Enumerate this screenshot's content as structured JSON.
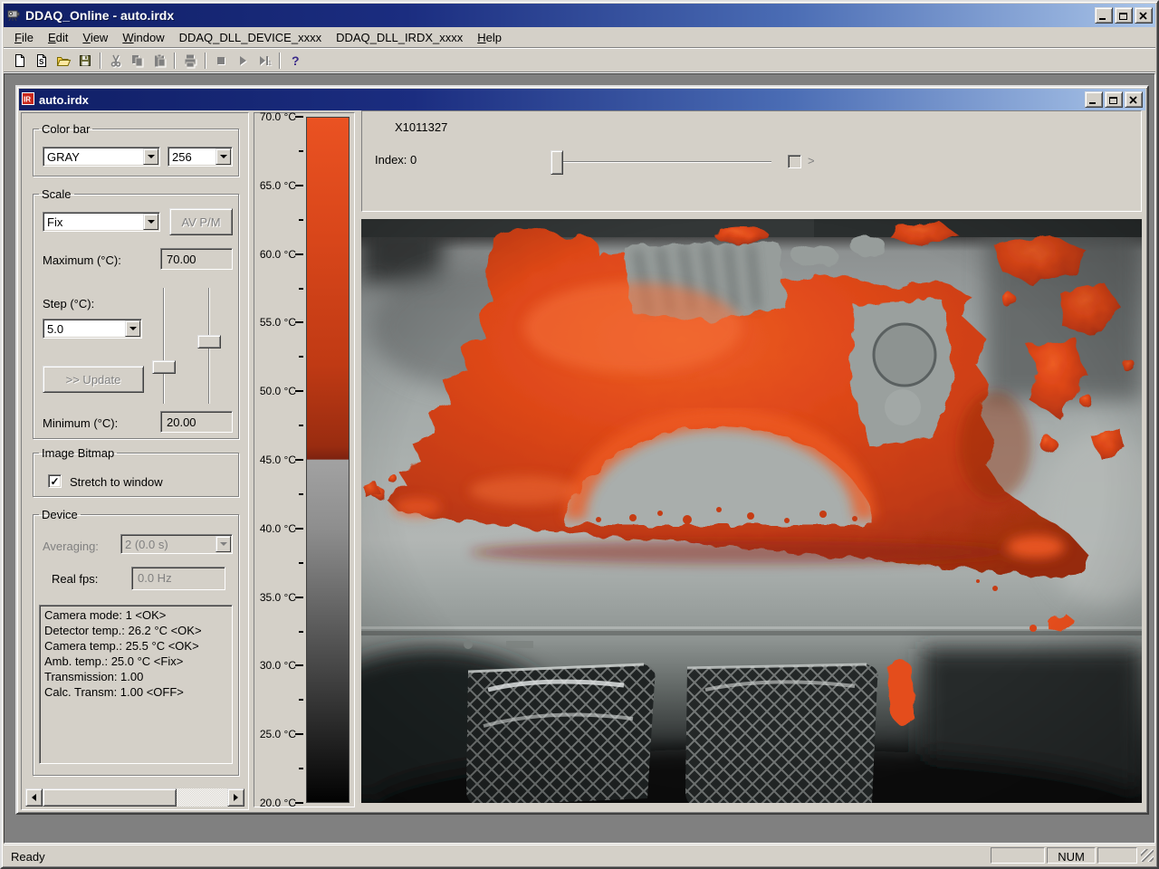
{
  "window": {
    "title": "DDAQ_Online - auto.irdx"
  },
  "menu": {
    "items": [
      {
        "label": "File"
      },
      {
        "label": "Edit"
      },
      {
        "label": "View"
      },
      {
        "label": "Window"
      },
      {
        "label": "DDAQ_DLL_DEVICE_xxxx"
      },
      {
        "label": "DDAQ_DLL_IRDX_xxxx"
      },
      {
        "label": "Help"
      }
    ]
  },
  "toolbar": {
    "buttons": [
      "new-file",
      "new-irdx",
      "open-file",
      "save-file",
      "cut",
      "copy",
      "paste",
      "print",
      "stop",
      "play",
      "play-single",
      "help-about"
    ]
  },
  "child": {
    "title": "auto.irdx"
  },
  "panel": {
    "colorbar_group": {
      "title": "Color bar",
      "palette": "GRAY",
      "levels": "256"
    },
    "scale_group": {
      "title": "Scale",
      "mode": "Fix",
      "avpm_label": "AV P/M",
      "maximum_label": "Maximum (°C):",
      "maximum": "70.00",
      "step_label": "Step (°C):",
      "step": "5.0",
      "update_label": ">> Update",
      "minimum_label": "Minimum (°C):",
      "minimum": "20.00"
    },
    "bitmap_group": {
      "title": "Image Bitmap",
      "stretch_label": "Stretch to window",
      "stretch_checked": "✓"
    },
    "device_group": {
      "title": "Device",
      "averaging_label": "Averaging:",
      "averaging": "2 (0.0 s)",
      "realfps_label": "Real fps:",
      "realfps": "0.0 Hz",
      "info_lines": [
        "Camera mode: 1 <OK>",
        "Detector temp.: 26.2 °C <OK>",
        "Camera temp.: 25.5 °C <OK>",
        "Amb. temp.: 25.0 °C <Fix>",
        "Transmission: 1.00",
        "Calc. Transm: 1.00 <OFF>"
      ]
    }
  },
  "colorscale": {
    "unit": "°C",
    "max": 70.0,
    "min": 20.0,
    "major_step": 5.0,
    "labels": [
      "70.0 °C",
      "65.0 °C",
      "60.0 °C",
      "55.0 °C",
      "50.0 °C",
      "45.0 °C",
      "40.0 °C",
      "35.0 °C",
      "30.0 °C",
      "25.0 °C",
      "20.0 °C"
    ],
    "red_top": "#ea5222",
    "red_bottom": "#7c2210",
    "gray_top": "#a2a2a2",
    "gray_bottom": "#020202"
  },
  "viewer": {
    "camera_id": "X1011327",
    "index_label": "Index: 0",
    "next_label": ">"
  },
  "statusbar": {
    "ready": "Ready",
    "num": "NUM"
  },
  "colors": {
    "face": "#d4d0c8",
    "desktop": "#808080",
    "titlebar_left": "#101f66",
    "titlebar_right": "#a9c4e8",
    "hot_red": "#dc4518"
  }
}
